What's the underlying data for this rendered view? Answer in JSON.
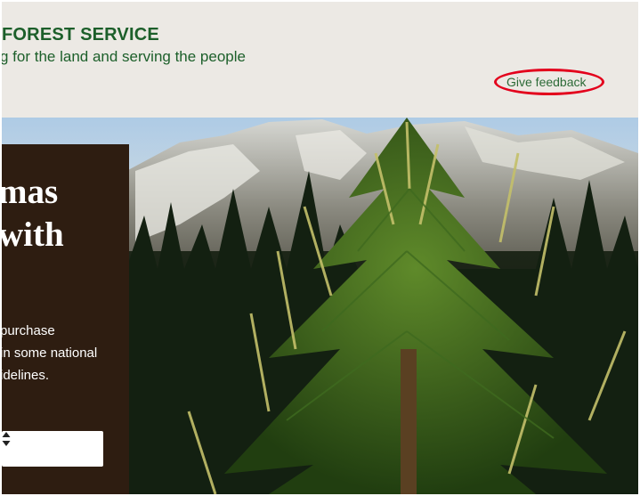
{
  "header": {
    "agency_name": "FOREST SERVICE",
    "tagline": "g for the land and serving the people",
    "feedback_label": "Give feedback",
    "feedback_highlight_color": "#e3001c",
    "brand_color": "#1c5f2a"
  },
  "hero": {
    "image": "pine-tree-mountain-photo",
    "card": {
      "title_lines": [
        "mas",
        "with"
      ],
      "body_lines": [
        "purchase",
        "in some national",
        "idelines."
      ],
      "select": {
        "value": "",
        "icon": "sort-arrows-icon"
      }
    }
  }
}
